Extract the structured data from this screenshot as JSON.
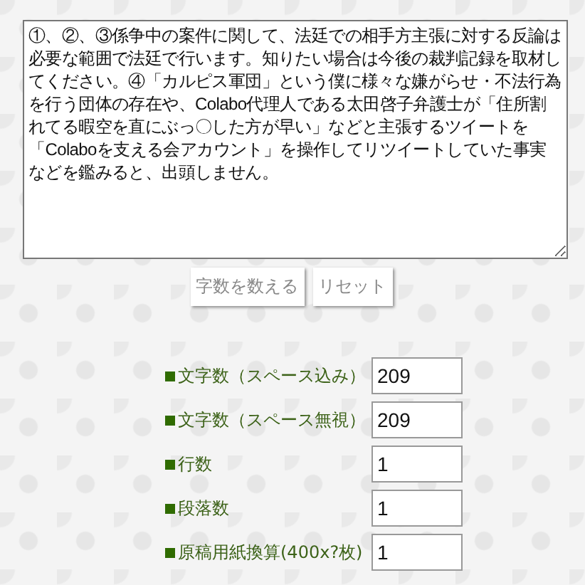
{
  "text_input": {
    "value": "①、②、③係争中の案件に関して、法廷での相手方主張に対する反論は必要な範囲で法廷で行います。知りたい場合は今後の裁判記録を取材してください。④「カルピス軍団」という僕に様々な嫌がらせ・不法行為を行う団体の存在や、Colabo代理人である太田啓子弁護士が「住所割れてる暇空を直にぶっ〇した方が早い」などと主張するツイートを「Colaboを支える会アカウント」を操作してリツイートしていた事実などを鑑みると、出頭しません。"
  },
  "buttons": [
    "字数を数える",
    "リセット"
  ],
  "results": [
    {
      "label": "文字数（スペース込み）",
      "value": "209"
    },
    {
      "label": "文字数（スペース無視）",
      "value": "209"
    },
    {
      "label": "行数",
      "value": "1"
    },
    {
      "label": "段落数",
      "value": "1"
    },
    {
      "label": "原稿用紙換算(400x?枚)",
      "value": "1"
    }
  ]
}
